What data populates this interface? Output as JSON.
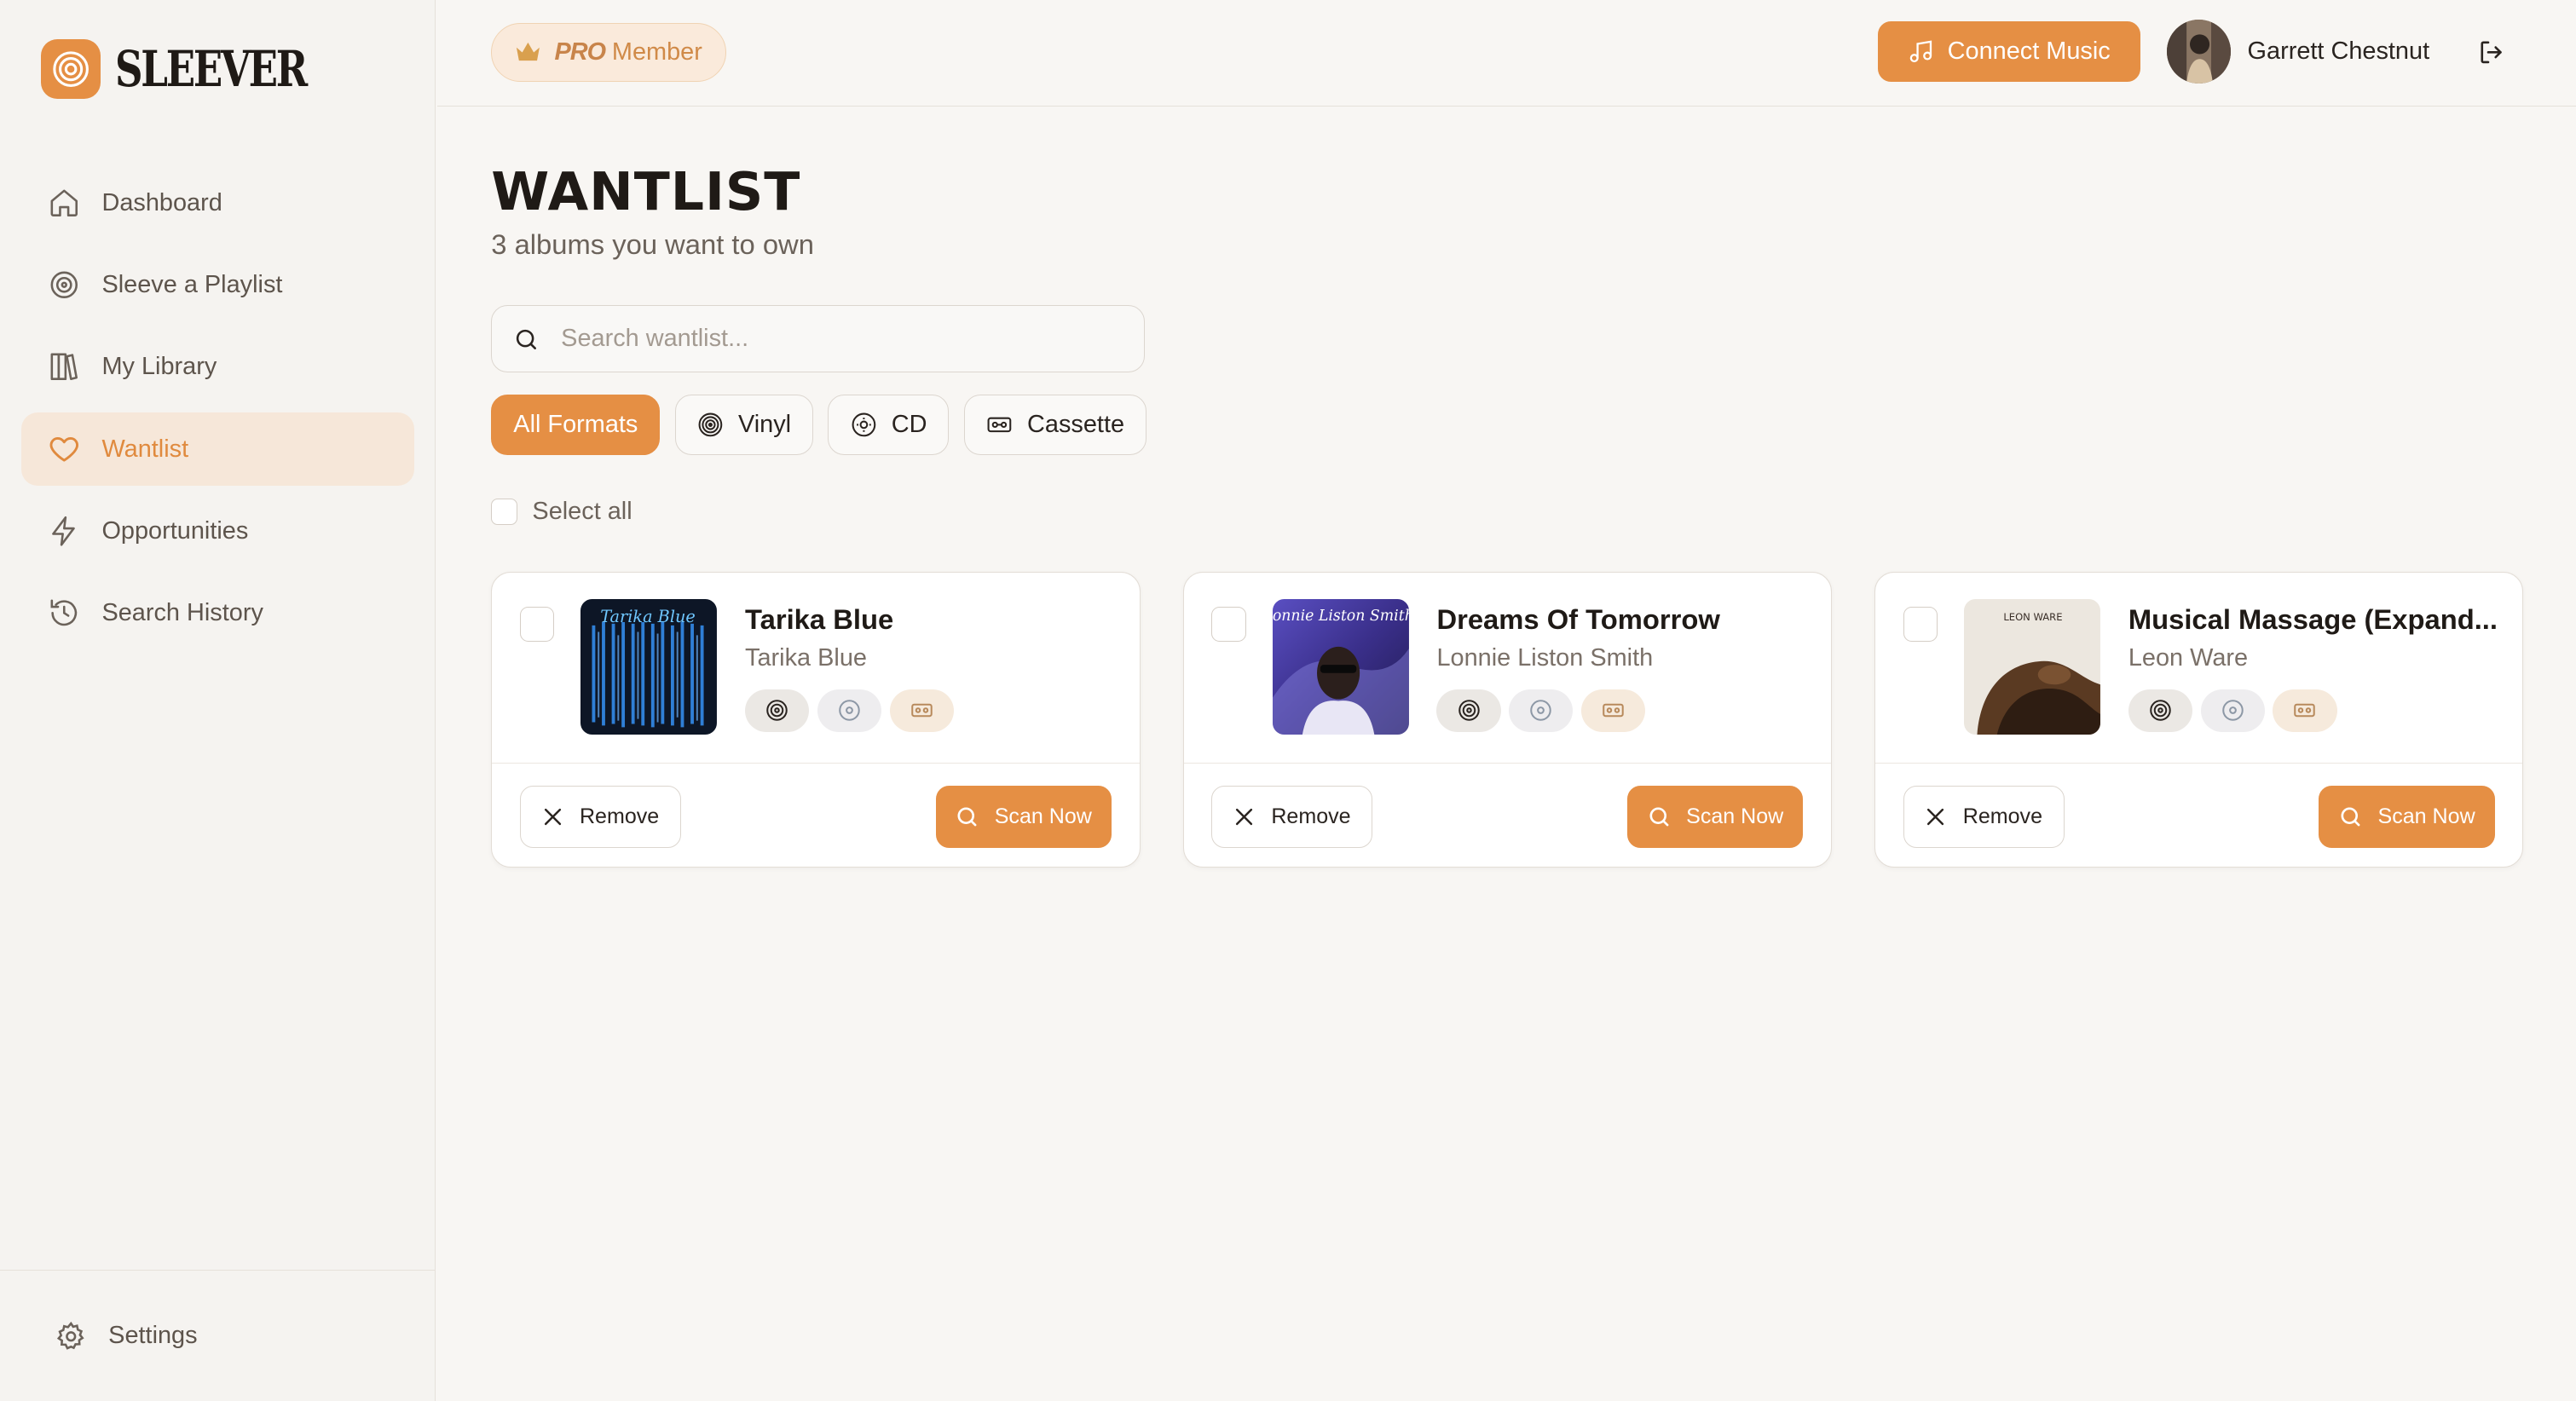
{
  "app": {
    "name": "SLEEVER"
  },
  "sidebar": {
    "items": [
      {
        "label": "Dashboard",
        "icon": "home-icon"
      },
      {
        "label": "Sleeve a Playlist",
        "icon": "disc-icon"
      },
      {
        "label": "My Library",
        "icon": "library-icon"
      },
      {
        "label": "Wantlist",
        "icon": "heart-icon",
        "active": true
      },
      {
        "label": "Opportunities",
        "icon": "bolt-icon"
      },
      {
        "label": "Search History",
        "icon": "history-icon"
      }
    ],
    "settings_label": "Settings"
  },
  "header": {
    "pro_word": "PRO",
    "pro_member": "Member",
    "connect_label": "Connect Music",
    "user_name": "Garrett Chestnut"
  },
  "page": {
    "title": "WANTLIST",
    "subtitle": "3 albums you want to own"
  },
  "search": {
    "placeholder": "Search wantlist..."
  },
  "filters": [
    {
      "label": "All Formats",
      "active": true
    },
    {
      "label": "Vinyl",
      "icon": "vinyl-icon"
    },
    {
      "label": "CD",
      "icon": "cd-icon"
    },
    {
      "label": "Cassette",
      "icon": "cassette-icon"
    }
  ],
  "select_all_label": "Select all",
  "albums": [
    {
      "title": "Tarika Blue",
      "artist": "Tarika Blue",
      "cover_text": "Tarika Blue"
    },
    {
      "title": "Dreams Of Tomorrow",
      "artist": "Lonnie Liston Smith",
      "cover_text": "Lonnie Liston Smith"
    },
    {
      "title": "Musical Massage (Expand...",
      "artist": "Leon Ware",
      "cover_text": "LEON WARE"
    }
  ],
  "card_actions": {
    "remove_label": "Remove",
    "scan_label": "Scan Now"
  },
  "colors": {
    "accent": "#e58f44",
    "active_bg": "#f6e7d9",
    "background": "#f8f6f3"
  }
}
